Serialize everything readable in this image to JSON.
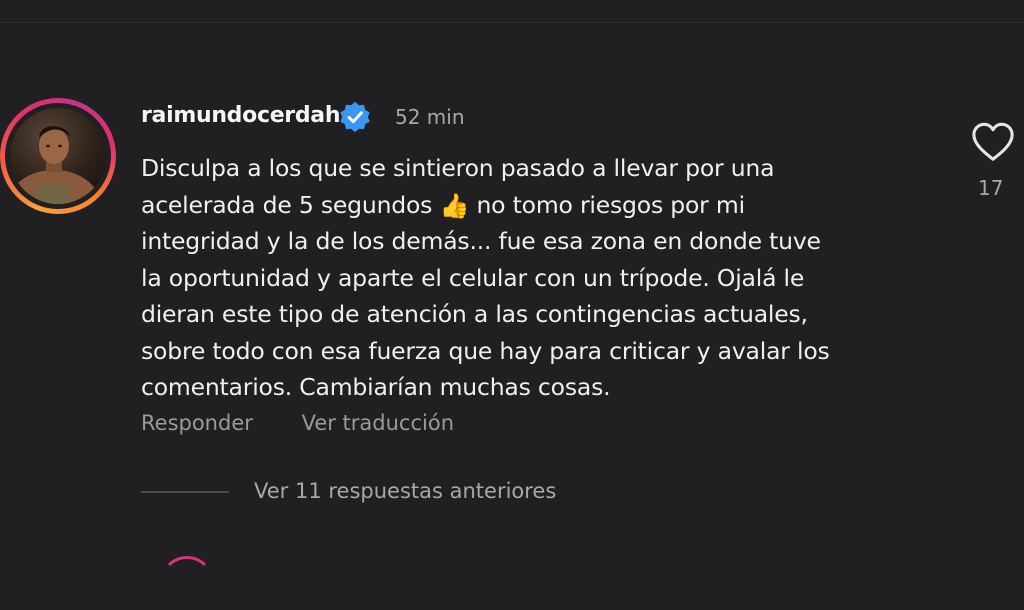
{
  "comment": {
    "username": "raimundocerdah",
    "verified": true,
    "timestamp": "52 min",
    "text_lines": [
      "Disculpa a los que se sintieron pasado a llevar por una",
      "acelerada de 5 segundos",
      "no tomo riesgos por mi",
      "integridad y la de los demás... fue esa zona en donde tuve",
      "la oportunidad y aparte el celular con un trípode. Ojalá le",
      "dieran este tipo de atención a las contingencias actuales,",
      "sobre todo con esa fuerza que hay para criticar y avalar los",
      "comentarios. Cambiarían muchas cosas."
    ],
    "emoji": "👍",
    "like_count": "17",
    "actions": {
      "reply": "Responder",
      "translate": "Ver traducción"
    }
  },
  "replies": {
    "label": "Ver 11 respuestas anteriores"
  },
  "icons": {
    "verified": "verified-badge-icon",
    "like": "heart-icon",
    "thumbs_up": "thumbs-up-emoji"
  },
  "colors": {
    "background": "#201f21",
    "verified_blue": "#3897f0",
    "muted_text": "#a8a8a8",
    "story_ring": "#e1306c"
  }
}
